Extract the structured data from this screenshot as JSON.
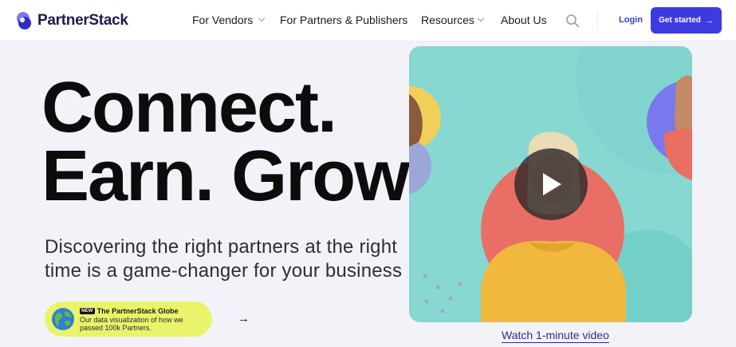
{
  "brand": {
    "name": "PartnerStack",
    "accent": "#3d3be0"
  },
  "nav": {
    "items": [
      {
        "label": "For Vendors",
        "has_dropdown": true
      },
      {
        "label": "For Partners & Publishers",
        "has_dropdown": false
      },
      {
        "label": "Resources",
        "has_dropdown": true
      },
      {
        "label": "About Us",
        "has_dropdown": false
      }
    ],
    "search_icon": "search-icon",
    "login_label": "Login",
    "cta_label": "Get started",
    "cta_icon": "arrow-right-icon"
  },
  "hero": {
    "headline_line1": "Connect.",
    "headline_line2": "Earn. Grow.",
    "subheadline": "Discovering the right partners at the right time is a game-changer for your business",
    "promo": {
      "badge": "NEW",
      "title": "The PartnerStack Globe",
      "description": "Our data visualization of how we passed 100k Partners.",
      "icon": "globe-icon",
      "arrow_icon": "arrow-right-icon",
      "background": "#e9f46b"
    }
  },
  "video": {
    "play_icon": "play-icon",
    "link_label": "Watch 1-minute video"
  }
}
